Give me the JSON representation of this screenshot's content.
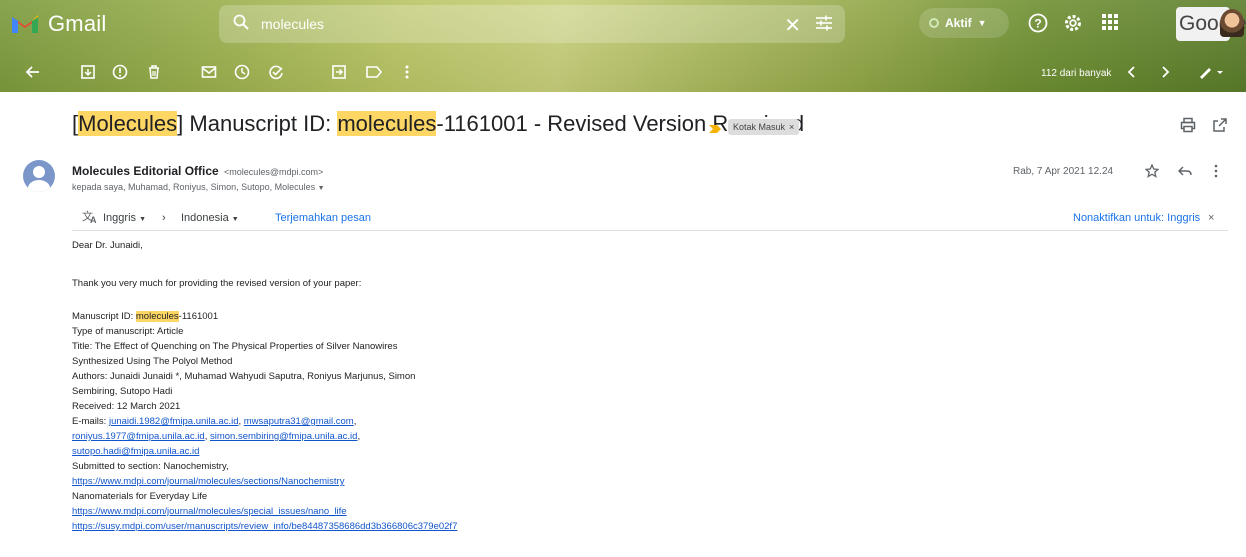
{
  "app": {
    "name": "Gmail"
  },
  "search": {
    "query": "molecules"
  },
  "status": {
    "label": "Aktif"
  },
  "account": {
    "google_label": "Google"
  },
  "toolbar": {
    "pager": "112 dari banyak"
  },
  "email": {
    "subject_parts": [
      "[",
      "Molecules",
      "] Manuscript ID: ",
      "molecules",
      "-1161001 - Revised Version Received"
    ],
    "label_tag": "Kotak Masuk",
    "sender_name": "Molecules Editorial Office",
    "sender_email": "<molecules@mdpi.com>",
    "recipients": "kepada saya, Muhamad, Roniyus, Simon, Sutopo, Molecules",
    "date": "Rab, 7 Apr 2021 12.24"
  },
  "translate": {
    "from_lang": "Inggris",
    "to_lang": "Indonesia",
    "translate_link": "Terjemahkan pesan",
    "disable": "Nonaktifkan untuk: Inggris"
  },
  "body": {
    "greeting": "Dear Dr. Junaidi,",
    "intro": "Thank you very much for providing the revised version of your paper:",
    "ms_id_prefix": "Manuscript ID: ",
    "ms_id_hl": "molecules",
    "ms_id_suffix": "-1161001",
    "type": "Type of manuscript: Article",
    "title1": "Title: The Effect of Quenching on The Physical Properties of Silver Nanowires",
    "title2": "Synthesized Using The Polyol Method",
    "authors1": "Authors: Junaidi Junaidi *, Muhamad Wahyudi Saputra, Roniyus Marjunus, Simon",
    "authors2": "Sembiring, Sutopo Hadi",
    "received": "Received: 12 March 2021",
    "emails_prefix": "E-mails: ",
    "email1": "junaidi.1982@fmipa.unila.ac.id",
    "email2": "mwsaputra31@gmail.com",
    "email3": "roniyus.1977@fmipa.unila.ac.id",
    "email4": "simon.sembiring@fmipa.unila.ac.id",
    "email5": "sutopo.hadi@fmipa.unila.ac.id",
    "section": "Submitted to section: Nanochemistry,",
    "section_link": "https://www.mdpi.com/journal/molecules/sections/Nanochemistry",
    "special": "Nanomaterials for Everyday Life",
    "special_link": "https://www.mdpi.com/journal/molecules/special_issues/nano_life",
    "review_link": "https://susy.mdpi.com/user/manuscripts/review_info/be84487358686dd3b366806c379e02f7"
  }
}
